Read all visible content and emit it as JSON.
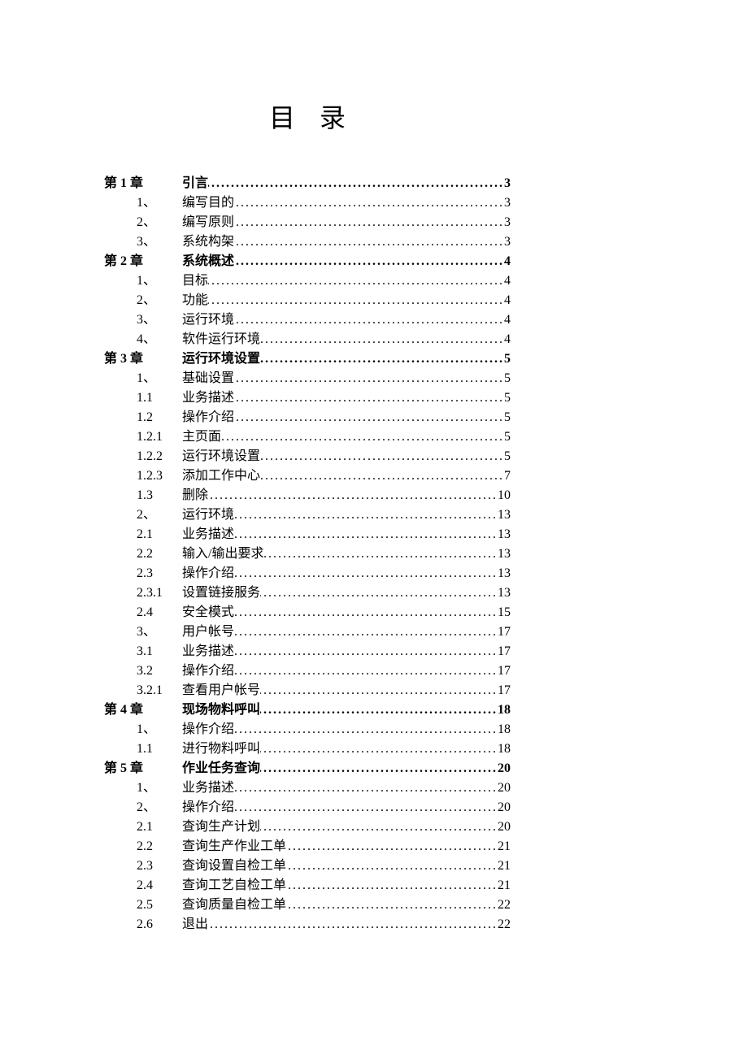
{
  "title": "目录",
  "entries": [
    {
      "label": "第 1 章",
      "text": "引言",
      "page": "3",
      "level": 0,
      "bold": true
    },
    {
      "label": "1、",
      "text": "编写目的",
      "page": "3",
      "level": 1,
      "bold": false
    },
    {
      "label": "2、",
      "text": "编写原则",
      "page": "3",
      "level": 1,
      "bold": false
    },
    {
      "label": "3、",
      "text": "系统构架",
      "page": "3",
      "level": 1,
      "bold": false
    },
    {
      "label": "第 2 章",
      "text": "系统概述",
      "page": "4",
      "level": 0,
      "bold": true
    },
    {
      "label": "1、",
      "text": "目标",
      "page": "4",
      "level": 1,
      "bold": false
    },
    {
      "label": "2、",
      "text": "功能",
      "page": "4",
      "level": 1,
      "bold": false
    },
    {
      "label": "3、",
      "text": "运行环境",
      "page": "4",
      "level": 1,
      "bold": false
    },
    {
      "label": "4、",
      "text": "软件运行环境",
      "page": "4",
      "level": 1,
      "bold": false
    },
    {
      "label": "第 3 章",
      "text": "运行环境设置",
      "page": "5",
      "level": 0,
      "bold": true
    },
    {
      "label": "1、",
      "text": "基础设置",
      "page": "5",
      "level": 1,
      "bold": false
    },
    {
      "label": "1.1",
      "text": "业务描述",
      "page": "5",
      "level": 2,
      "bold": false
    },
    {
      "label": "1.2",
      "text": "操作介绍",
      "page": "5",
      "level": 2,
      "bold": false
    },
    {
      "label": "1.2.1",
      "text": "主页面",
      "page": "5",
      "level": 3,
      "bold": false
    },
    {
      "label": "1.2.2",
      "text": "运行环境设置",
      "page": "5",
      "level": 3,
      "bold": false
    },
    {
      "label": "1.2.3",
      "text": "添加工作中心",
      "page": "7",
      "level": 3,
      "bold": false
    },
    {
      "label": "1.3",
      "text": "删除",
      "page": "10",
      "level": 2,
      "bold": false
    },
    {
      "label": "2、",
      "text": "运行环境",
      "page": "13",
      "level": 1,
      "bold": false
    },
    {
      "label": "2.1",
      "text": "业务描述",
      "page": "13",
      "level": 2,
      "bold": false
    },
    {
      "label": "2.2",
      "text": "输入/输出要求",
      "page": "13",
      "level": 2,
      "bold": false
    },
    {
      "label": "2.3",
      "text": "操作介绍",
      "page": "13",
      "level": 2,
      "bold": false
    },
    {
      "label": "2.3.1",
      "text": "设置链接服务",
      "page": "13",
      "level": 3,
      "bold": false
    },
    {
      "label": "2.4",
      "text": "安全模式",
      "page": "15",
      "level": 2,
      "bold": false
    },
    {
      "label": "3、",
      "text": "用户帐号",
      "page": "17",
      "level": 1,
      "bold": false
    },
    {
      "label": "3.1",
      "text": "业务描述",
      "page": "17",
      "level": 2,
      "bold": false
    },
    {
      "label": "3.2",
      "text": "操作介绍",
      "page": "17",
      "level": 2,
      "bold": false
    },
    {
      "label": "3.2.1",
      "text": "查看用户帐号",
      "page": "17",
      "level": 3,
      "bold": false
    },
    {
      "label": "第 4 章",
      "text": "现场物料呼叫",
      "page": "18",
      "level": 0,
      "bold": true
    },
    {
      "label": "1、",
      "text": "操作介绍",
      "page": "18",
      "level": 1,
      "bold": false
    },
    {
      "label": "1.1",
      "text": "进行物料呼叫",
      "page": "18",
      "level": 2,
      "bold": false
    },
    {
      "label": "第 5 章",
      "text": "作业任务查询",
      "page": "20",
      "level": 0,
      "bold": true
    },
    {
      "label": "1、",
      "text": "业务描述",
      "page": "20",
      "level": 1,
      "bold": false
    },
    {
      "label": "2、",
      "text": "操作介绍",
      "page": "20",
      "level": 1,
      "bold": false
    },
    {
      "label": "2.1",
      "text": "查询生产计划",
      "page": "20",
      "level": 2,
      "bold": false
    },
    {
      "label": "2.2",
      "text": "查询生产作业工单",
      "page": "21",
      "level": 2,
      "bold": false
    },
    {
      "label": "2.3",
      "text": "查询设置自检工单",
      "page": "21",
      "level": 2,
      "bold": false
    },
    {
      "label": "2.4",
      "text": "查询工艺自检工单",
      "page": "21",
      "level": 2,
      "bold": false
    },
    {
      "label": "2.5",
      "text": "查询质量自检工单",
      "page": "22",
      "level": 2,
      "bold": false
    },
    {
      "label": "2.6",
      "text": "退出",
      "page": "22",
      "level": 2,
      "bold": false
    }
  ]
}
